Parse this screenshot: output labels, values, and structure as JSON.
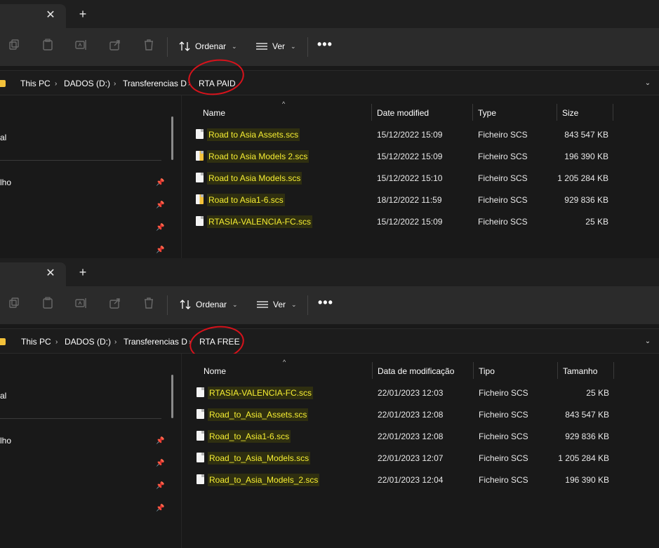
{
  "panes": [
    {
      "toolbar": {
        "sort_label": "Ordenar",
        "view_label": "Ver",
        "more_label": "•••"
      },
      "breadcrumb": [
        "This PC",
        "DADOS (D:)",
        "Transferencias D",
        "RTA PAID"
      ],
      "nav": {
        "label_1": "al",
        "label_2": "lho"
      },
      "columns": [
        "Name",
        "Date modified",
        "Type",
        "Size"
      ],
      "files": [
        {
          "name": "Road to Asia Assets.scs",
          "date": "15/12/2022 15:09",
          "type": "Ficheiro SCS",
          "size": "843 547 KB",
          "icon": "file-icon"
        },
        {
          "name": "Road to Asia Models 2.scs",
          "date": "15/12/2022 15:09",
          "type": "Ficheiro SCS",
          "size": "196 390 KB",
          "icon": "file-icon-yellow"
        },
        {
          "name": "Road to Asia Models.scs",
          "date": "15/12/2022 15:10",
          "type": "Ficheiro SCS",
          "size": "1 205 284 KB",
          "icon": "file-icon"
        },
        {
          "name": "Road to Asia1-6.scs",
          "date": "18/12/2022 11:59",
          "type": "Ficheiro SCS",
          "size": "929 836 KB",
          "icon": "file-icon-yellow"
        },
        {
          "name": "RTASIA-VALENCIA-FC.scs",
          "date": "15/12/2022 15:09",
          "type": "Ficheiro SCS",
          "size": "25 KB",
          "icon": "file-icon"
        }
      ]
    },
    {
      "toolbar": {
        "sort_label": "Ordenar",
        "view_label": "Ver",
        "more_label": "•••"
      },
      "breadcrumb": [
        "This PC",
        "DADOS (D:)",
        "Transferencias D",
        "RTA FREE"
      ],
      "nav": {
        "label_1": "al",
        "label_2": "lho"
      },
      "columns": [
        "Nome",
        "Data de modificação",
        "Tipo",
        "Tamanho"
      ],
      "files": [
        {
          "name": "RTASIA-VALENCIA-FC.scs",
          "date": "22/01/2023 12:03",
          "type": "Ficheiro SCS",
          "size": "25 KB",
          "icon": "file-icon"
        },
        {
          "name": "Road_to_Asia_Assets.scs",
          "date": "22/01/2023 12:08",
          "type": "Ficheiro SCS",
          "size": "843 547 KB",
          "icon": "file-icon"
        },
        {
          "name": "Road_to_Asia1-6.scs",
          "date": "22/01/2023 12:08",
          "type": "Ficheiro SCS",
          "size": "929 836 KB",
          "icon": "file-icon"
        },
        {
          "name": "Road_to_Asia_Models.scs",
          "date": "22/01/2023 12:07",
          "type": "Ficheiro SCS",
          "size": "1 205 284 KB",
          "icon": "file-icon"
        },
        {
          "name": "Road_to_Asia_Models_2.scs",
          "date": "22/01/2023 12:04",
          "type": "Ficheiro SCS",
          "size": "196 390 KB",
          "icon": "file-icon"
        }
      ]
    }
  ],
  "colors": {
    "highlight_text": "#f7ef32",
    "annotation_circle": "#d8121b",
    "folder": "#f3c13a"
  }
}
